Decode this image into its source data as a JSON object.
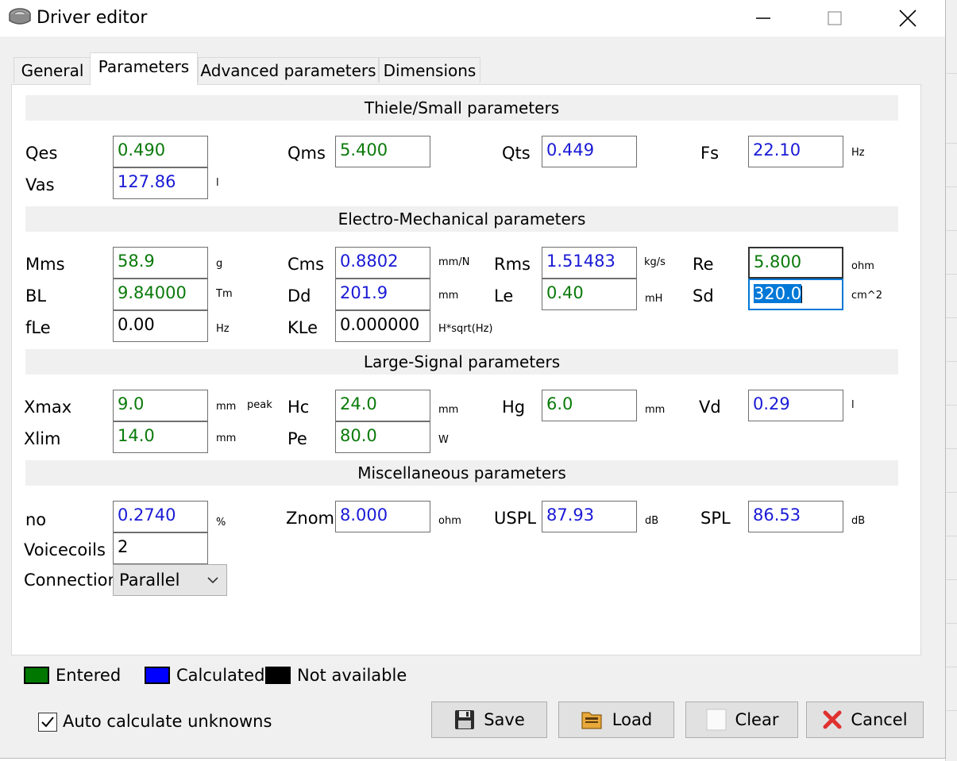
{
  "window": {
    "title": "Driver editor"
  },
  "tabs": [
    {
      "label": "General"
    },
    {
      "label": "Parameters"
    },
    {
      "label": "Advanced parameters"
    },
    {
      "label": "Dimensions"
    }
  ],
  "sections": {
    "ts": "Thiele/Small parameters",
    "em": "Electro-Mechanical parameters",
    "ls": "Large-Signal parameters",
    "misc": "Miscellaneous parameters"
  },
  "fields": {
    "qes": {
      "label": "Qes",
      "value": "0.490",
      "unit": "",
      "state": "entered"
    },
    "qms": {
      "label": "Qms",
      "value": "5.400",
      "unit": "",
      "state": "entered"
    },
    "qts": {
      "label": "Qts",
      "value": "0.449",
      "unit": "",
      "state": "calculated"
    },
    "fs": {
      "label": "Fs",
      "value": "22.10",
      "unit": "Hz",
      "state": "calculated"
    },
    "vas": {
      "label": "Vas",
      "value": "127.86",
      "unit": "l",
      "state": "calculated"
    },
    "mms": {
      "label": "Mms",
      "value": "58.9",
      "unit": "g",
      "state": "entered"
    },
    "cms": {
      "label": "Cms",
      "value": "0.8802",
      "unit": "mm/N",
      "state": "calculated"
    },
    "rms": {
      "label": "Rms",
      "value": "1.51483",
      "unit": "kg/s",
      "state": "calculated"
    },
    "re": {
      "label": "Re",
      "value": "5.800",
      "unit": "ohm",
      "state": "entered"
    },
    "bl": {
      "label": "BL",
      "value": "9.84000",
      "unit": "Tm",
      "state": "entered"
    },
    "dd": {
      "label": "Dd",
      "value": "201.9",
      "unit": "mm",
      "state": "calculated"
    },
    "le": {
      "label": "Le",
      "value": "0.40",
      "unit": "mH",
      "state": "entered"
    },
    "sd": {
      "label": "Sd",
      "value": "320.0",
      "unit": "cm^2",
      "state": "selected"
    },
    "fle": {
      "label": "fLe",
      "value": "0.00",
      "unit": "Hz",
      "state": "na"
    },
    "kle": {
      "label": "KLe",
      "value": "0.000000",
      "unit": "H*sqrt(Hz)",
      "state": "na"
    },
    "xmax": {
      "label": "Xmax",
      "value": "9.0",
      "unit": "mm",
      "unit2": "peak",
      "state": "entered"
    },
    "hc": {
      "label": "Hc",
      "value": "24.0",
      "unit": "mm",
      "state": "entered"
    },
    "hg": {
      "label": "Hg",
      "value": "6.0",
      "unit": "mm",
      "state": "entered"
    },
    "vd": {
      "label": "Vd",
      "value": "0.29",
      "unit": "l",
      "state": "calculated"
    },
    "xlim": {
      "label": "Xlim",
      "value": "14.0",
      "unit": "mm",
      "state": "entered"
    },
    "pe": {
      "label": "Pe",
      "value": "80.0",
      "unit": "W",
      "state": "entered"
    },
    "no": {
      "label": "no",
      "value": "0.2740",
      "unit": "%",
      "state": "calculated"
    },
    "znom": {
      "label": "Znom",
      "value": "8.000",
      "unit": "ohm",
      "state": "calculated"
    },
    "uspl": {
      "label": "USPL",
      "value": "87.93",
      "unit": "dB",
      "state": "calculated"
    },
    "spl": {
      "label": "SPL",
      "value": "86.53",
      "unit": "dB",
      "state": "calculated"
    },
    "voicecoils": {
      "label": "Voicecoils",
      "value": "2",
      "state": "na"
    },
    "connection": {
      "label": "Connection",
      "value": "Parallel"
    }
  },
  "legend": {
    "entered": {
      "label": "Entered",
      "color": "#007800"
    },
    "calculated": {
      "label": "Calculated",
      "color": "#0000ff"
    },
    "na": {
      "label": "Not available",
      "color": "#000000"
    }
  },
  "auto_calc": {
    "label": "Auto calculate unknowns",
    "checked": true
  },
  "buttons": {
    "save": "Save",
    "load": "Load",
    "clear": "Clear",
    "cancel": "Cancel"
  }
}
